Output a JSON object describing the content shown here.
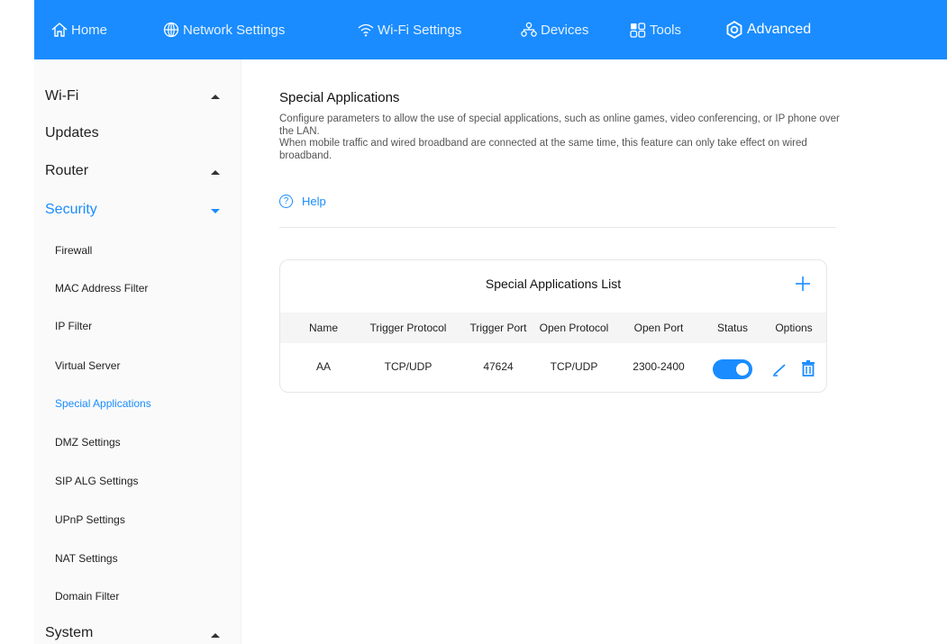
{
  "nav": {
    "items": [
      {
        "label": "Home",
        "icon": "home-icon"
      },
      {
        "label": "Network Settings",
        "icon": "globe-icon"
      },
      {
        "label": "Wi-Fi Settings",
        "icon": "wifi-icon"
      },
      {
        "label": "Devices",
        "icon": "devices-icon"
      },
      {
        "label": "Tools",
        "icon": "tools-icon"
      },
      {
        "label": "Advanced",
        "icon": "gear-icon"
      }
    ],
    "active": "Advanced",
    "accent": "#1a8cff"
  },
  "sidebar": {
    "main": [
      {
        "label": "Wi-Fi",
        "arrow": "up"
      },
      {
        "label": "Updates"
      },
      {
        "label": "Router",
        "arrow": "up"
      },
      {
        "label": "Security",
        "arrow": "down",
        "active": true
      },
      {
        "label": "System",
        "arrow": "up"
      }
    ],
    "sub": [
      {
        "label": "Firewall"
      },
      {
        "label": "MAC Address Filter"
      },
      {
        "label": "IP Filter"
      },
      {
        "label": "Virtual Server"
      },
      {
        "label": "Special Applications",
        "active": true
      },
      {
        "label": "DMZ Settings"
      },
      {
        "label": "SIP ALG Settings"
      },
      {
        "label": "UPnP Settings"
      },
      {
        "label": "NAT Settings"
      },
      {
        "label": "Domain Filter"
      }
    ]
  },
  "content": {
    "title": "Special Applications",
    "desc1": "Configure parameters to allow the use of special applications, such as online games, video conferencing, or IP phone over the LAN.",
    "desc2": "When mobile traffic and wired broadband are connected at the same time, this feature can only take effect on wired broadband.",
    "help_label": "Help",
    "help_icon_glyph": "?"
  },
  "table": {
    "title": "Special Applications List",
    "columns": [
      "Name",
      "Trigger Protocol",
      "Trigger Port",
      "Open Protocol",
      "Open Port",
      "Status",
      "Options"
    ],
    "rows": [
      {
        "name": "AA",
        "trigger_protocol": "TCP/UDP",
        "trigger_port": "47624",
        "open_protocol": "TCP/UDP",
        "open_port": "2300-2400",
        "status": "on"
      }
    ]
  }
}
